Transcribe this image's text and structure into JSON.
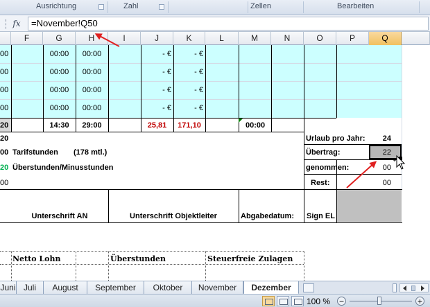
{
  "ribbon": {
    "groups": [
      "Ausrichtung",
      "Zahl",
      "Zellen",
      "Bearbeiten"
    ]
  },
  "formula_bar": {
    "fx_label": "fx",
    "formula": "=November!Q50"
  },
  "columns": [
    "F",
    "G",
    "H",
    "I",
    "J",
    "K",
    "L",
    "M",
    "N",
    "O",
    "P",
    "Q"
  ],
  "selected_column": "Q",
  "rows": {
    "band_rows": [
      {
        "e": "00",
        "g": "00:00",
        "h": "00:00",
        "j": "-  €",
        "k": "-  €"
      },
      {
        "e": "00",
        "g": "00:00",
        "h": "00:00",
        "j": "-  €",
        "k": "-  €"
      },
      {
        "e": "00",
        "g": "00:00",
        "h": "00:00",
        "j": "-  €",
        "k": "-  €"
      },
      {
        "e": "00",
        "g": "00:00",
        "h": "00:00",
        "j": "-  €",
        "k": "-  €"
      }
    ],
    "totals": {
      "e": "20",
      "g": "14:30",
      "h": "29:00",
      "j": "25,81",
      "k": "171,10",
      "m": "00:00"
    }
  },
  "summary": {
    "row1_left": "20",
    "tarif_num": "00",
    "tarif_label": "Tarifstunden",
    "tarif_note": "(178 mtl.)",
    "ueber_num": "20",
    "ueber_label": "Überstunden/Minusstunden",
    "row4_left": "00"
  },
  "urlaub": {
    "pro_jahr_label": "Urlaub pro Jahr:",
    "pro_jahr_value": "24",
    "uebertrag_label": "Übertrag:",
    "uebertrag_value": "22",
    "genommen_label": "genommen:",
    "genommen_value": "00",
    "rest_label": "Rest:",
    "rest_value": "00"
  },
  "signatures": {
    "an": "Unterschrift AN",
    "objektleiter": "Unterschrift Objektleiter",
    "abgabedatum": "Abgabedatum:",
    "sign_el": "Sign EL"
  },
  "lower_table": {
    "headers": [
      "Netto Lohn",
      "Überstunden",
      "Steuerfreie Zulagen"
    ]
  },
  "sheet_tabs": [
    "Juni",
    "Juli",
    "August",
    "September",
    "Oktober",
    "November",
    "Dezember"
  ],
  "active_tab": "Dezember",
  "status": {
    "zoom": "100 %"
  }
}
